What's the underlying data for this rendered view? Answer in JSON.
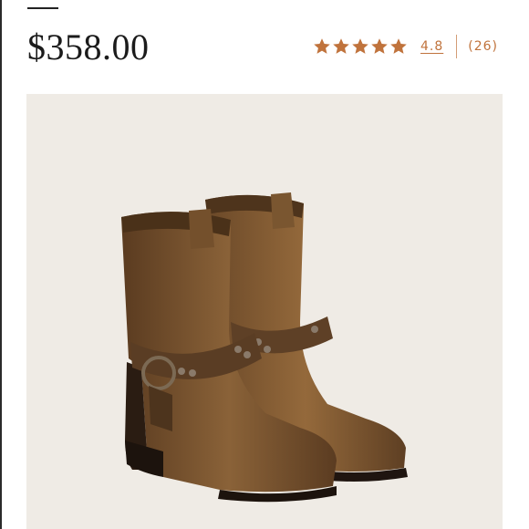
{
  "product": {
    "price": "$358.00",
    "image_alt": "Brown leather harness boots"
  },
  "rating": {
    "value": "4.8",
    "count": "(26)",
    "stars": 5,
    "icon": "star-icon",
    "color": "#c0733c"
  },
  "colors": {
    "image_background": "#efebe5",
    "leather": "#6b4a2b"
  }
}
